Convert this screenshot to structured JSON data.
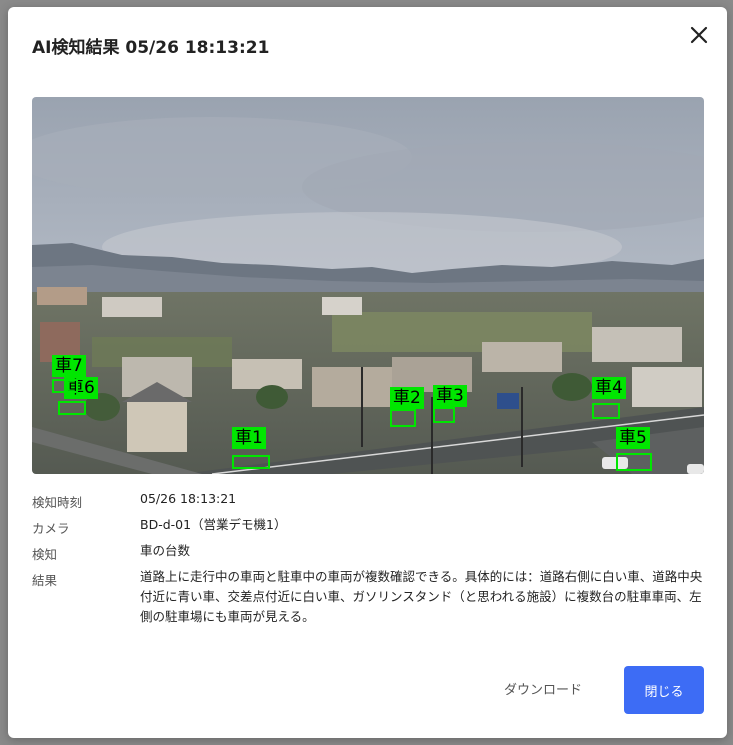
{
  "dialog": {
    "title": "AI検知結果 05/26 18:13:21",
    "download_label": "ダウンロード",
    "close_label": "閉じる"
  },
  "detections": [
    {
      "label": "車1"
    },
    {
      "label": "車2"
    },
    {
      "label": "車3"
    },
    {
      "label": "車4"
    },
    {
      "label": "車5"
    },
    {
      "label": "車6"
    },
    {
      "label": "車7"
    }
  ],
  "info": [
    {
      "key": "検知時刻",
      "value": "05/26 18:13:21"
    },
    {
      "key": "カメラ",
      "value": "BD-d-01（営業デモ機1）"
    },
    {
      "key": "検知",
      "value": "車の台数"
    },
    {
      "key": "結果",
      "value": "道路上に走行中の車両と駐車中の車両が複数確認できる。具体的には：道路右側に白い車、道路中央付近に青い車、交差点付近に白い車、ガソリンスタンド（と思われる施設）に複数台の駐車車両、左側の駐車場にも車両が見える。"
    }
  ],
  "colors": {
    "detection": "#00e600",
    "primary_button": "#3d6cf5"
  }
}
